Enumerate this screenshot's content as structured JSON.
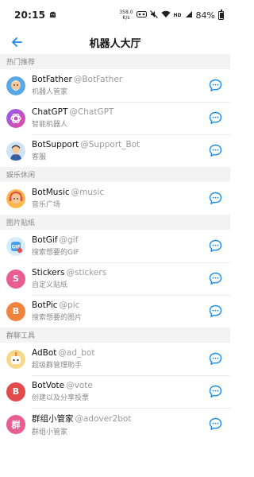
{
  "status": {
    "time": "20:15",
    "net_speed_value": "358.0",
    "net_speed_unit": "K/s",
    "battery": "84%"
  },
  "appbar": {
    "title": "机器人大厅",
    "back_icon": "arrow-left-icon",
    "accent": "#1a8ce8"
  },
  "sections": [
    {
      "label": "热门推荐",
      "bots": [
        {
          "name": "BotFather",
          "handle": "@BotFather",
          "desc": "机器人管家",
          "avatar": "father"
        },
        {
          "name": "ChatGPT",
          "handle": "@ChatGPT",
          "desc": "智能机器人",
          "avatar": "gpt"
        },
        {
          "name": "BotSupport",
          "handle": "@Support_Bot",
          "desc": "客服",
          "avatar": "support"
        }
      ]
    },
    {
      "label": "娱乐休闲",
      "bots": [
        {
          "name": "BotMusic",
          "handle": "@music",
          "desc": "音乐广场",
          "avatar": "music"
        }
      ]
    },
    {
      "label": "图片贴纸",
      "bots": [
        {
          "name": "BotGif",
          "handle": "@gif",
          "desc": "搜索想要的GIF",
          "avatar": "gif"
        },
        {
          "name": "Stickers",
          "handle": "@stickers",
          "desc": "自定义贴纸",
          "avatar": "letter",
          "letter": "S",
          "color": "#e85d92"
        },
        {
          "name": "BotPic",
          "handle": "@pic",
          "desc": "搜索想要的图片",
          "avatar": "letter",
          "letter": "B",
          "color": "#f0843f"
        }
      ]
    },
    {
      "label": "群聊工具",
      "bots": [
        {
          "name": "AdBot",
          "handle": "@ad_bot",
          "desc": "超级群管理助手",
          "avatar": "adbot"
        },
        {
          "name": "BotVote",
          "handle": "@vote",
          "desc": "创建以及分享投票",
          "avatar": "letter",
          "letter": "B",
          "color": "#e24b4b"
        },
        {
          "name": "群组小管家",
          "handle": "@adover2bot",
          "desc": "群组小管家",
          "avatar": "letter",
          "letter": "群",
          "color": "#e85d92"
        }
      ]
    }
  ]
}
